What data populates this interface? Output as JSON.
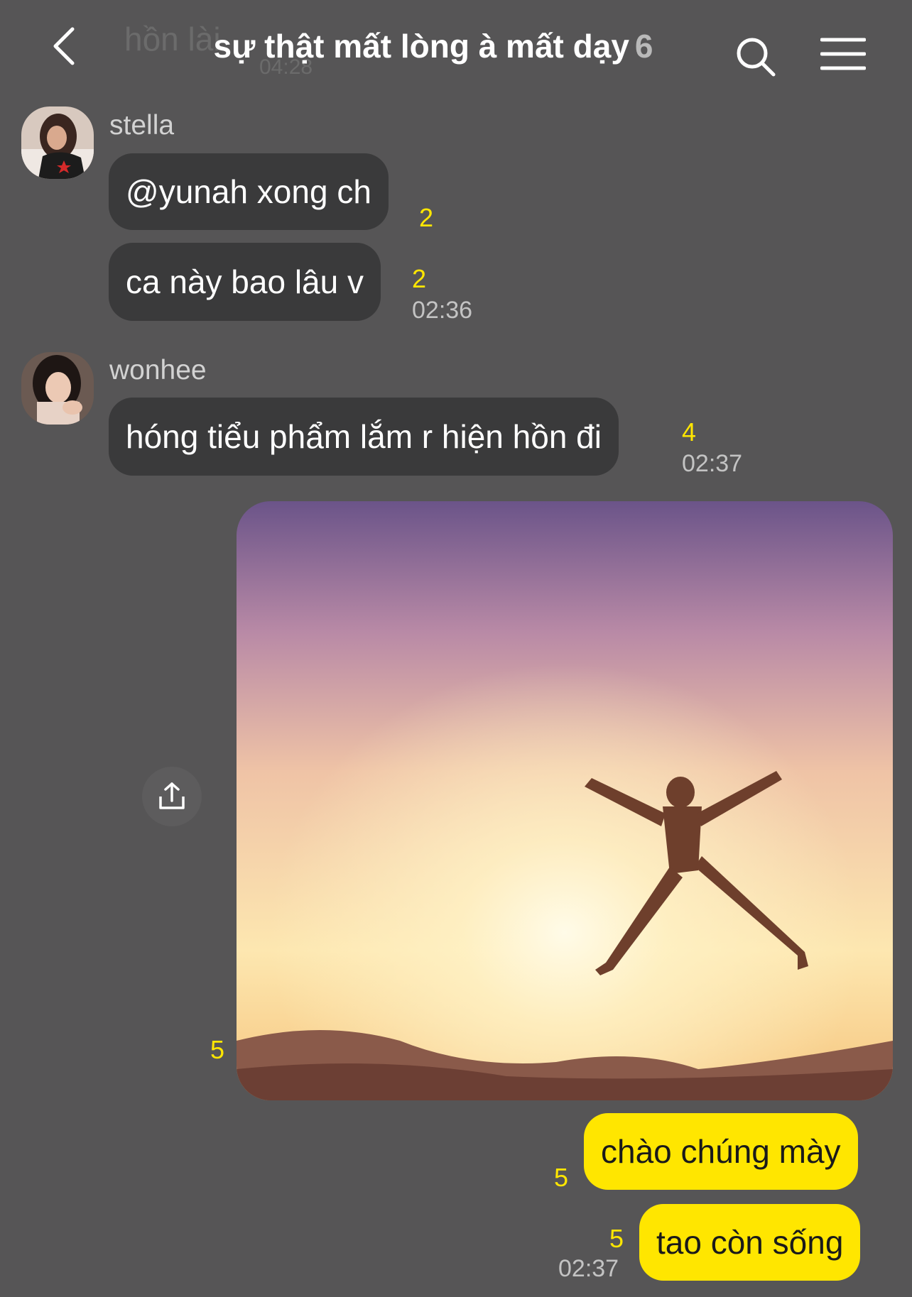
{
  "header": {
    "back_icon": "chevron-left-icon",
    "ghost_text": "hồn lài",
    "ghost_time": "04:28",
    "title": "sự thật mất lòng à mất dạy",
    "member_count": "6",
    "search_icon": "search-icon",
    "menu_icon": "hamburger-menu-icon"
  },
  "messages": [
    {
      "sender": "stella",
      "text": "@yunah xong ch",
      "unread": "2",
      "time": ""
    },
    {
      "sender": "stella",
      "text": "ca này bao lâu v",
      "unread": "2",
      "time": "02:36"
    },
    {
      "sender": "wonhee",
      "text": "hóng tiểu phẩm lắm r hiện hồn đi",
      "unread": "4",
      "time": "02:37"
    }
  ],
  "photo_message": {
    "unread": "5",
    "share_icon": "share-icon"
  },
  "my_messages": [
    {
      "text": "chào chúng mày",
      "unread": "5",
      "time": ""
    },
    {
      "text": "tao còn sống",
      "unread": "5",
      "time": "02:37"
    }
  ],
  "colors": {
    "background": "#565556",
    "bubble_other": "#3a3a3b",
    "bubble_me": "#ffe600",
    "unread": "#ffe600"
  }
}
